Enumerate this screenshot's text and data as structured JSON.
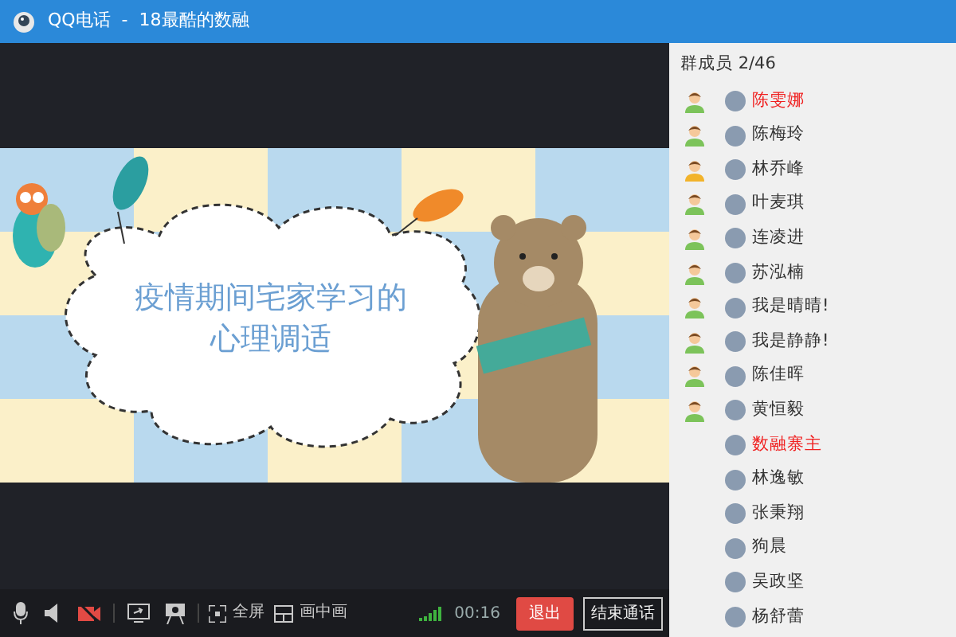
{
  "window": {
    "title": "QQ电话  -  18最酷的数融"
  },
  "slide": {
    "title_lines": [
      "疫情期间宅家学习的",
      "心理调适"
    ]
  },
  "toolbar": {
    "items": [
      {
        "kind": "mic",
        "off": false
      },
      {
        "kind": "speaker",
        "off": false
      },
      {
        "kind": "camera",
        "off": true
      },
      {
        "kind": "share",
        "off": false
      },
      {
        "kind": "present",
        "off": false
      },
      {
        "kind": "fullscreen",
        "label": "全屏"
      },
      {
        "kind": "pip",
        "label": "画中画"
      }
    ],
    "timer": "00:16",
    "exit_button": "退出",
    "end_button": "结束通话"
  },
  "members": {
    "header": "群成员 2/46",
    "items": [
      {
        "name": "陈雯娜",
        "highlighted": true,
        "in_call": true,
        "color": "#7cc35a"
      },
      {
        "name": "陈梅玲",
        "highlighted": false,
        "in_call": true,
        "color": "#7cc35a"
      },
      {
        "name": "林乔峰",
        "highlighted": false,
        "in_call": true,
        "color": "#f2b32b"
      },
      {
        "name": "叶麦琪",
        "highlighted": false,
        "in_call": true,
        "color": "#7cc35a"
      },
      {
        "name": "连凌进",
        "highlighted": false,
        "in_call": true,
        "color": "#7cc35a"
      },
      {
        "name": "苏泓楠",
        "highlighted": false,
        "in_call": true,
        "color": "#7cc35a"
      },
      {
        "name": "我是晴晴!",
        "highlighted": false,
        "in_call": true,
        "color": "#7cc35a"
      },
      {
        "name": "我是静静!",
        "highlighted": false,
        "in_call": true,
        "color": "#7cc35a"
      },
      {
        "name": "陈佳晖",
        "highlighted": false,
        "in_call": true,
        "color": "#7cc35a"
      },
      {
        "name": "黄恒毅",
        "highlighted": false,
        "in_call": true,
        "color": "#7cc35a"
      },
      {
        "name": "数融寨主",
        "highlighted": true,
        "in_call": false
      },
      {
        "name": "林逸敏",
        "highlighted": false,
        "in_call": false
      },
      {
        "name": "张秉翔",
        "highlighted": false,
        "in_call": false
      },
      {
        "name": "狗晨",
        "highlighted": false,
        "in_call": false
      },
      {
        "name": "吴政坚",
        "highlighted": false,
        "in_call": false
      },
      {
        "name": "杨舒蕾",
        "highlighted": false,
        "in_call": false
      }
    ]
  }
}
